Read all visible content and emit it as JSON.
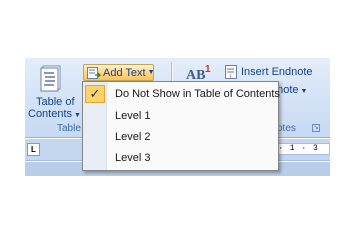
{
  "ribbon": {
    "toc": {
      "label_line1": "Table of",
      "label_line2": "Contents",
      "icon": "table-of-contents-icon",
      "group_label": "Table"
    },
    "add_text": {
      "label": "Add Text",
      "icon": "add-text-icon"
    },
    "footnotes": {
      "insert_footnote_icon": "insert-footnote-ab-icon",
      "insert_footnote_glyph": "AB",
      "insert_footnote_superscript": "1",
      "insert_endnote_label": "Insert Endnote",
      "insert_endnote_icon": "insert-endnote-icon",
      "next_footnote_label": "dnote",
      "group_label": "otes"
    },
    "launcher_icon": "dialog-launcher-icon"
  },
  "ruler": {
    "tab_selector": "L",
    "marks": "· 2 · 1 · 3"
  },
  "menu": {
    "items": [
      {
        "label": "Do Not Show in Table of Contents",
        "checked": true
      },
      {
        "label": "Level 1",
        "checked": false
      },
      {
        "label": "Level 2",
        "checked": false
      },
      {
        "label": "Level 3",
        "checked": false
      }
    ],
    "check_glyph": "✓"
  },
  "colors": {
    "accent_highlight": "#ffd36b",
    "ribbon_text": "#15428b",
    "ribbon_bg": "#d6e4f7"
  }
}
